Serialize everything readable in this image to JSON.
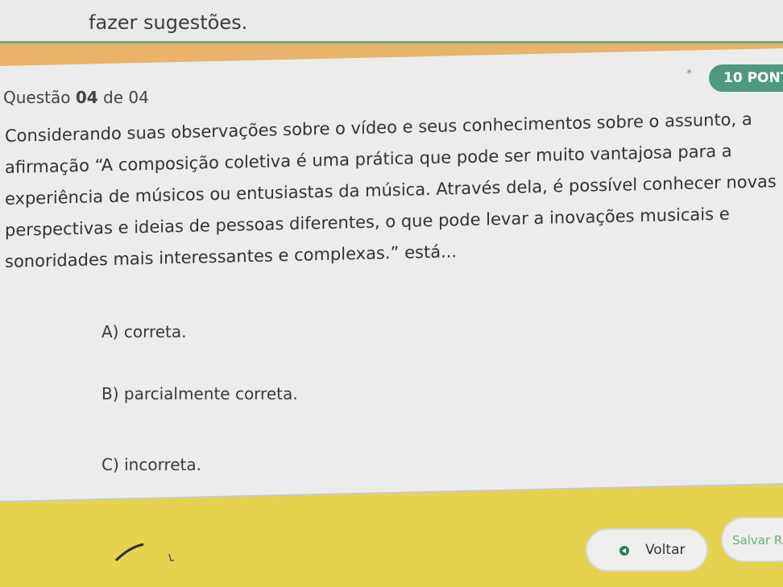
{
  "header": {
    "previous_text": "fazer sugestões."
  },
  "question": {
    "label_prefix": "Questão",
    "number": "04",
    "label_suffix": "de 04",
    "points": "10 PONT",
    "star": "*",
    "text_lines": [
      "Considerando suas observações sobre o vídeo e seus conhecimentos sobre o assunto, a",
      "afirmação “A composição coletiva é uma prática que pode ser muito vantajosa para a",
      "experiência de músicos ou entusiastas da música. Através dela, é possível conhecer novas",
      "perspectivas e ideias de pessoas diferentes, o que pode levar a inovações musicais e",
      "sonoridades mais interessantes e complexas.” está..."
    ]
  },
  "options": [
    {
      "label": "A) correta."
    },
    {
      "label": "B) parcialmente correta."
    },
    {
      "label": "C) incorreta."
    }
  ],
  "footer": {
    "back_label": "Voltar",
    "save_label": "Salvar Ra"
  },
  "colors": {
    "background": "#e7d24f",
    "card": "#ebeceb",
    "accent_green": "#4f9a7e",
    "strip_orange": "#e9b36a"
  }
}
